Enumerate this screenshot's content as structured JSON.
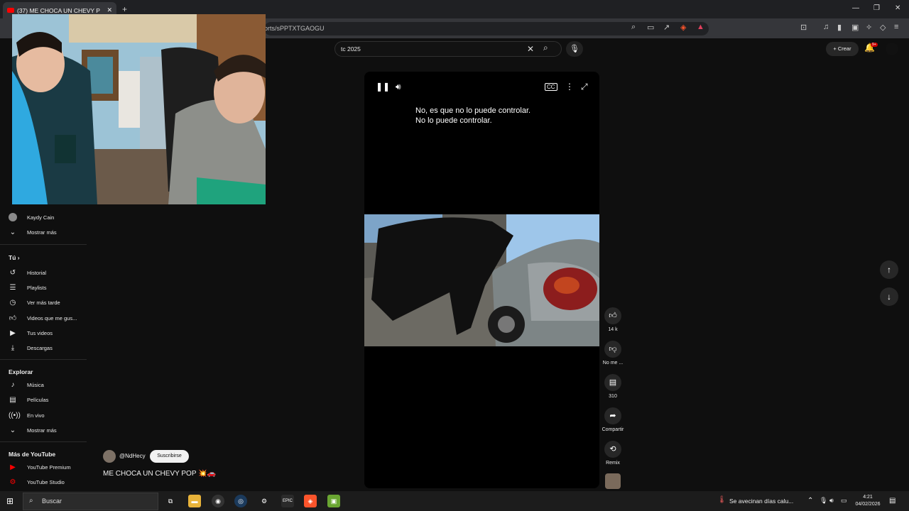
{
  "browser": {
    "tab_title": "(37) ME CHOCA UN CHEVY P",
    "address_fragment": "orts/sPPTXTGAOGU"
  },
  "header": {
    "search_value": "tc 2025",
    "create_label": "Crear",
    "notifications_badge": "9+"
  },
  "sidebar": {
    "subscriptions": [
      {
        "label": "Kaydy Cain"
      },
      {
        "label": "Mostrar más",
        "icon": "chevron-down-icon"
      }
    ],
    "you_heading": "Tú",
    "you_items": [
      {
        "label": "Historial",
        "icon": "history-icon"
      },
      {
        "label": "Playlists",
        "icon": "playlist-icon"
      },
      {
        "label": "Ver más tarde",
        "icon": "clock-icon"
      },
      {
        "label": "Videos que me gus...",
        "icon": "like-icon"
      },
      {
        "label": "Tus videos",
        "icon": "video-icon"
      },
      {
        "label": "Descargas",
        "icon": "download-icon"
      }
    ],
    "explore_heading": "Explorar",
    "explore_items": [
      {
        "label": "Música",
        "icon": "music-icon"
      },
      {
        "label": "Películas",
        "icon": "film-icon"
      },
      {
        "label": "En vivo",
        "icon": "live-icon"
      },
      {
        "label": "Mostrar más",
        "icon": "chevron-down-icon"
      }
    ],
    "more_heading": "Más de YouTube",
    "more_items": [
      {
        "label": "YouTube Premium",
        "icon": "youtube-premium-icon"
      },
      {
        "label": "YouTube Studio",
        "icon": "youtube-studio-icon"
      }
    ]
  },
  "player": {
    "subtitle_line1": "No, es que no lo puede controlar.",
    "subtitle_line2": "No lo puede controlar."
  },
  "actions": {
    "like_count": "14 k",
    "dislike_label": "No me ...",
    "comments_count": "310",
    "share_label": "Compartir",
    "remix_label": "Remix"
  },
  "channel": {
    "handle": "@NdHecy",
    "subscribe_label": "Suscribirse",
    "short_title": "ME CHOCA UN CHEVY POP 💥🚗"
  },
  "taskbar": {
    "search_placeholder": "Buscar",
    "weather_text": "Se avecinan días calu...",
    "time": "4:21",
    "date": "04/02/2026"
  },
  "colors": {
    "background": "#0f0f0f",
    "youtube_red": "#ff0000",
    "subscribe_bg": "#f1f1f1"
  }
}
